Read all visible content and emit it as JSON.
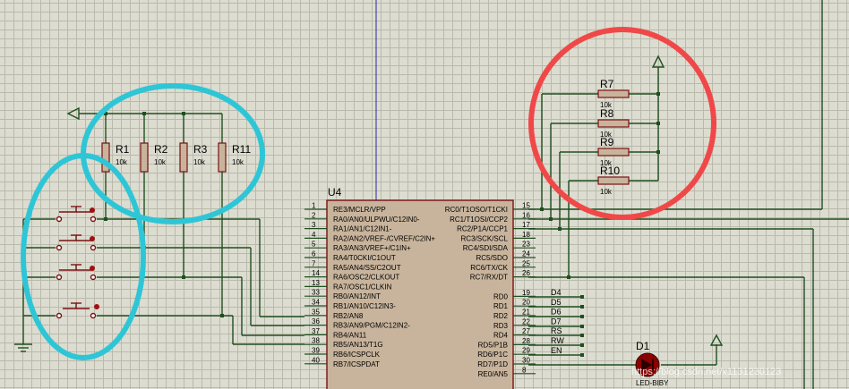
{
  "chip": {
    "ref": "U4",
    "left_pins": [
      {
        "num": "1",
        "name": "RE3/MCLR/VPP"
      },
      {
        "num": "2",
        "name": "RA0/AN0/ULPWU/C12IN0-"
      },
      {
        "num": "3",
        "name": "RA1/AN1/C12IN1-"
      },
      {
        "num": "4",
        "name": "RA2/AN2/VREF-/CVREF/C2IN+"
      },
      {
        "num": "5",
        "name": "RA3/AN3/VREF+/C1IN+"
      },
      {
        "num": "6",
        "name": "RA4/T0CKI/C1OUT"
      },
      {
        "num": "7",
        "name": "RA5/AN4/SS/C2OUT"
      },
      {
        "num": "14",
        "name": "RA6/OSC2/CLKOUT"
      },
      {
        "num": "13",
        "name": "RA7/OSC1/CLKIN"
      },
      {
        "num": "33",
        "name": "RB0/AN12/INT"
      },
      {
        "num": "34",
        "name": "RB1/AN10/C12IN3-"
      },
      {
        "num": "35",
        "name": "RB2/AN8"
      },
      {
        "num": "36",
        "name": "RB3/AN9/PGM/C12IN2-"
      },
      {
        "num": "37",
        "name": "RB4/AN11"
      },
      {
        "num": "38",
        "name": "RB5/AN13/T1G"
      },
      {
        "num": "39",
        "name": "RB6/ICSPCLK"
      },
      {
        "num": "40",
        "name": "RB7/ICSPDAT"
      }
    ],
    "right_pins": [
      {
        "num": "15",
        "name": "RC0/T1OSO/T1CKI"
      },
      {
        "num": "16",
        "name": "RC1/T1OSI/CCP2"
      },
      {
        "num": "17",
        "name": "RC2/P1A/CCP1"
      },
      {
        "num": "18",
        "name": "RC3/SCK/SCL"
      },
      {
        "num": "23",
        "name": "RC4/SDI/SDA"
      },
      {
        "num": "24",
        "name": "RC5/SDO"
      },
      {
        "num": "25",
        "name": "RC6/TX/CK"
      },
      {
        "num": "26",
        "name": "RC7/RX/DT"
      },
      {
        "num": "19",
        "name": "RD0"
      },
      {
        "num": "20",
        "name": "RD1"
      },
      {
        "num": "21",
        "name": "RD2"
      },
      {
        "num": "22",
        "name": "RD3"
      },
      {
        "num": "27",
        "name": "RD4"
      },
      {
        "num": "28",
        "name": "RD5/P1B"
      },
      {
        "num": "29",
        "name": "RD6/P1C"
      },
      {
        "num": "30",
        "name": "RD7/P1D"
      },
      {
        "num": "8",
        "name": "RE0/AN5"
      }
    ]
  },
  "net_labels": [
    "D4",
    "D5",
    "D6",
    "D7",
    "RS",
    "RW",
    "EN"
  ],
  "pullup_resistors": [
    {
      "ref": "R1",
      "value": "10k"
    },
    {
      "ref": "R2",
      "value": "10k"
    },
    {
      "ref": "R3",
      "value": "10k"
    },
    {
      "ref": "R11",
      "value": "10k"
    }
  ],
  "right_resistors": [
    {
      "ref": "R7",
      "value": "10k"
    },
    {
      "ref": "R8",
      "value": "10k"
    },
    {
      "ref": "R9",
      "value": "10k"
    },
    {
      "ref": "R10",
      "value": "10k"
    }
  ],
  "led": {
    "ref": "D1",
    "value": "LED-BIBY"
  },
  "watermark": "https://blog.csdn.net/x1131230123",
  "colors": {
    "background": "#dcdcd0",
    "wire": "#1f4f1f",
    "component_body": "#c8b49c",
    "component_outline": "#7a1010",
    "cyan_annotation": "#2ec6d6",
    "red_annotation": "#f04848",
    "led": "#8b0000"
  }
}
